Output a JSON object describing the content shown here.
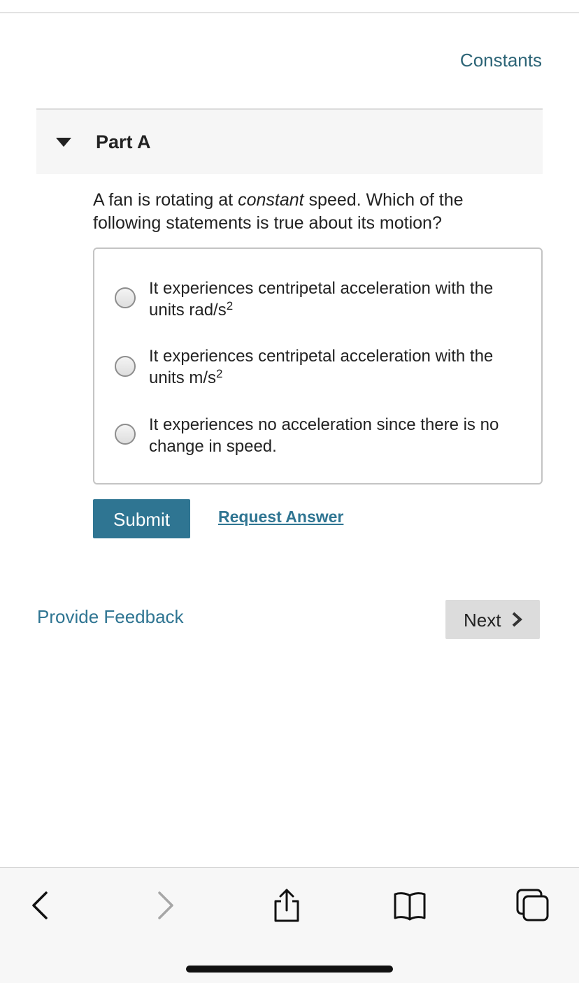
{
  "header": {
    "constants_link": "Constants"
  },
  "part": {
    "title": "Part A"
  },
  "question": {
    "text_before": "A fan is rotating at ",
    "text_emphasis": "constant",
    "text_after": " speed. Which of the following statements is true about its motion?"
  },
  "options": [
    {
      "text": "It experiences centripetal acceleration with the units rad/s",
      "superscript": "2",
      "selected": false
    },
    {
      "text": "It experiences centripetal acceleration with the units m/s",
      "superscript": "2",
      "selected": false
    },
    {
      "text": "It experiences no acceleration since there is no change in speed.",
      "superscript": "",
      "selected": false
    }
  ],
  "actions": {
    "submit_label": "Submit",
    "request_answer_label": "Request Answer"
  },
  "footer": {
    "feedback_label": "Provide Feedback",
    "next_label": "Next"
  },
  "browser_toolbar": {
    "icons": [
      "back-arrow-icon",
      "forward-arrow-icon",
      "share-icon",
      "bookmarks-icon",
      "tabs-icon"
    ]
  },
  "colors": {
    "accent": "#2f7592",
    "link_dark": "#2c6476",
    "next_button_bg": "#dcdcdc"
  }
}
